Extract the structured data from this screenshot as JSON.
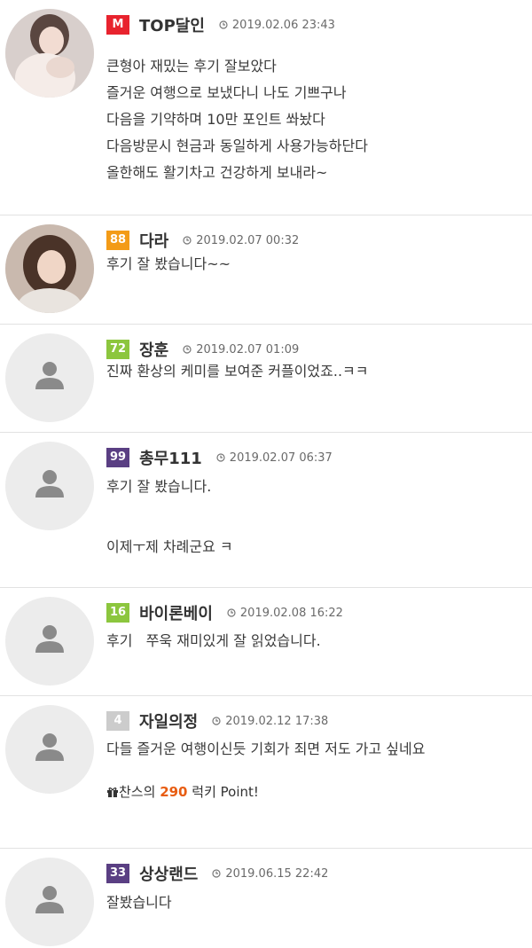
{
  "colors": {
    "badge_m": "#e8232e",
    "badge_88": "#f39b17",
    "badge_72": "#8cc63e",
    "badge_99": "#5a3f83",
    "badge_16": "#8cc63e",
    "badge_4": "#cccccc",
    "badge_33": "#5a3f83",
    "point_value": "#e85d12"
  },
  "comments": [
    {
      "badge": "M",
      "nickname": "TOP달인",
      "date": "2019.02.06 23:43",
      "avatar": "photo",
      "lines": [
        "큰형아 재밌는 후기 잘보았다",
        "즐거운 여행으로 보냈다니 나도 기쁘구나",
        "다음을 기약하며 10만 포인트 쏴놨다",
        "다음방문시 현금과 동일하게 사용가능하단다",
        "올한해도 활기차고 건강하게 보내라~"
      ]
    },
    {
      "badge": "88",
      "nickname": "다라",
      "date": "2019.02.07 00:32",
      "avatar": "photo",
      "lines": [
        "후기 잘 봤습니다~~"
      ]
    },
    {
      "badge": "72",
      "nickname": "장훈",
      "date": "2019.02.07 01:09",
      "avatar": "default",
      "lines": [
        "진짜 환상의 케미를 보여준 커플이었죠..ㅋㅋ"
      ]
    },
    {
      "badge": "99",
      "nickname": "총무111",
      "date": "2019.02.07 06:37",
      "avatar": "default",
      "lines": [
        "후기 잘 봤습니다.",
        "이제ㅜ제 차례군요 ㅋ"
      ]
    },
    {
      "badge": "16",
      "nickname": "바이론베이",
      "date": "2019.02.08 16:22",
      "avatar": "default",
      "lines": [
        "후기   쭈욱 재미있게 잘 읽었습니다."
      ]
    },
    {
      "badge": "4",
      "nickname": "자일의정",
      "date": "2019.02.12 17:38",
      "avatar": "default",
      "lines": [
        "다들 즐거운 여행이신듯 기회가 죄면 저도 가고 싶네요"
      ],
      "point": {
        "prefix": "찬스의",
        "value": "290",
        "suffix": "럭키 Point!"
      }
    },
    {
      "badge": "33",
      "nickname": "상상랜드",
      "date": "2019.06.15 22:42",
      "avatar": "default",
      "lines": [
        "잘봤습니다"
      ]
    }
  ]
}
